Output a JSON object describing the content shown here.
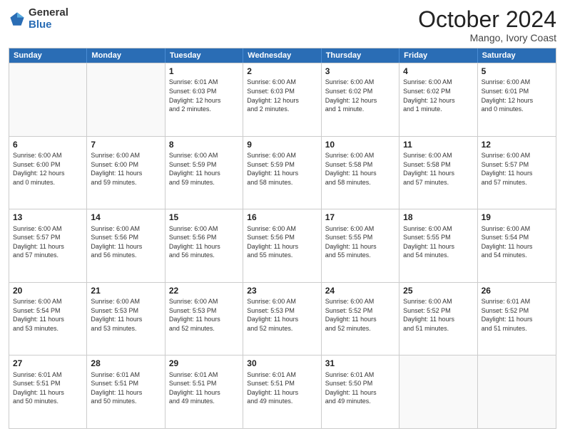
{
  "header": {
    "logo_general": "General",
    "logo_blue": "Blue",
    "month_title": "October 2024",
    "location": "Mango, Ivory Coast"
  },
  "days_of_week": [
    "Sunday",
    "Monday",
    "Tuesday",
    "Wednesday",
    "Thursday",
    "Friday",
    "Saturday"
  ],
  "weeks": [
    [
      {
        "day": "",
        "empty": true
      },
      {
        "day": "",
        "empty": true
      },
      {
        "day": "1",
        "lines": [
          "Sunrise: 6:01 AM",
          "Sunset: 6:03 PM",
          "Daylight: 12 hours",
          "and 2 minutes."
        ]
      },
      {
        "day": "2",
        "lines": [
          "Sunrise: 6:00 AM",
          "Sunset: 6:03 PM",
          "Daylight: 12 hours",
          "and 2 minutes."
        ]
      },
      {
        "day": "3",
        "lines": [
          "Sunrise: 6:00 AM",
          "Sunset: 6:02 PM",
          "Daylight: 12 hours",
          "and 1 minute."
        ]
      },
      {
        "day": "4",
        "lines": [
          "Sunrise: 6:00 AM",
          "Sunset: 6:02 PM",
          "Daylight: 12 hours",
          "and 1 minute."
        ]
      },
      {
        "day": "5",
        "lines": [
          "Sunrise: 6:00 AM",
          "Sunset: 6:01 PM",
          "Daylight: 12 hours",
          "and 0 minutes."
        ]
      }
    ],
    [
      {
        "day": "6",
        "lines": [
          "Sunrise: 6:00 AM",
          "Sunset: 6:00 PM",
          "Daylight: 12 hours",
          "and 0 minutes."
        ]
      },
      {
        "day": "7",
        "lines": [
          "Sunrise: 6:00 AM",
          "Sunset: 6:00 PM",
          "Daylight: 11 hours",
          "and 59 minutes."
        ]
      },
      {
        "day": "8",
        "lines": [
          "Sunrise: 6:00 AM",
          "Sunset: 5:59 PM",
          "Daylight: 11 hours",
          "and 59 minutes."
        ]
      },
      {
        "day": "9",
        "lines": [
          "Sunrise: 6:00 AM",
          "Sunset: 5:59 PM",
          "Daylight: 11 hours",
          "and 58 minutes."
        ]
      },
      {
        "day": "10",
        "lines": [
          "Sunrise: 6:00 AM",
          "Sunset: 5:58 PM",
          "Daylight: 11 hours",
          "and 58 minutes."
        ]
      },
      {
        "day": "11",
        "lines": [
          "Sunrise: 6:00 AM",
          "Sunset: 5:58 PM",
          "Daylight: 11 hours",
          "and 57 minutes."
        ]
      },
      {
        "day": "12",
        "lines": [
          "Sunrise: 6:00 AM",
          "Sunset: 5:57 PM",
          "Daylight: 11 hours",
          "and 57 minutes."
        ]
      }
    ],
    [
      {
        "day": "13",
        "lines": [
          "Sunrise: 6:00 AM",
          "Sunset: 5:57 PM",
          "Daylight: 11 hours",
          "and 57 minutes."
        ]
      },
      {
        "day": "14",
        "lines": [
          "Sunrise: 6:00 AM",
          "Sunset: 5:56 PM",
          "Daylight: 11 hours",
          "and 56 minutes."
        ]
      },
      {
        "day": "15",
        "lines": [
          "Sunrise: 6:00 AM",
          "Sunset: 5:56 PM",
          "Daylight: 11 hours",
          "and 56 minutes."
        ]
      },
      {
        "day": "16",
        "lines": [
          "Sunrise: 6:00 AM",
          "Sunset: 5:56 PM",
          "Daylight: 11 hours",
          "and 55 minutes."
        ]
      },
      {
        "day": "17",
        "lines": [
          "Sunrise: 6:00 AM",
          "Sunset: 5:55 PM",
          "Daylight: 11 hours",
          "and 55 minutes."
        ]
      },
      {
        "day": "18",
        "lines": [
          "Sunrise: 6:00 AM",
          "Sunset: 5:55 PM",
          "Daylight: 11 hours",
          "and 54 minutes."
        ]
      },
      {
        "day": "19",
        "lines": [
          "Sunrise: 6:00 AM",
          "Sunset: 5:54 PM",
          "Daylight: 11 hours",
          "and 54 minutes."
        ]
      }
    ],
    [
      {
        "day": "20",
        "lines": [
          "Sunrise: 6:00 AM",
          "Sunset: 5:54 PM",
          "Daylight: 11 hours",
          "and 53 minutes."
        ]
      },
      {
        "day": "21",
        "lines": [
          "Sunrise: 6:00 AM",
          "Sunset: 5:53 PM",
          "Daylight: 11 hours",
          "and 53 minutes."
        ]
      },
      {
        "day": "22",
        "lines": [
          "Sunrise: 6:00 AM",
          "Sunset: 5:53 PM",
          "Daylight: 11 hours",
          "and 52 minutes."
        ]
      },
      {
        "day": "23",
        "lines": [
          "Sunrise: 6:00 AM",
          "Sunset: 5:53 PM",
          "Daylight: 11 hours",
          "and 52 minutes."
        ]
      },
      {
        "day": "24",
        "lines": [
          "Sunrise: 6:00 AM",
          "Sunset: 5:52 PM",
          "Daylight: 11 hours",
          "and 52 minutes."
        ]
      },
      {
        "day": "25",
        "lines": [
          "Sunrise: 6:00 AM",
          "Sunset: 5:52 PM",
          "Daylight: 11 hours",
          "and 51 minutes."
        ]
      },
      {
        "day": "26",
        "lines": [
          "Sunrise: 6:01 AM",
          "Sunset: 5:52 PM",
          "Daylight: 11 hours",
          "and 51 minutes."
        ]
      }
    ],
    [
      {
        "day": "27",
        "lines": [
          "Sunrise: 6:01 AM",
          "Sunset: 5:51 PM",
          "Daylight: 11 hours",
          "and 50 minutes."
        ]
      },
      {
        "day": "28",
        "lines": [
          "Sunrise: 6:01 AM",
          "Sunset: 5:51 PM",
          "Daylight: 11 hours",
          "and 50 minutes."
        ]
      },
      {
        "day": "29",
        "lines": [
          "Sunrise: 6:01 AM",
          "Sunset: 5:51 PM",
          "Daylight: 11 hours",
          "and 49 minutes."
        ]
      },
      {
        "day": "30",
        "lines": [
          "Sunrise: 6:01 AM",
          "Sunset: 5:51 PM",
          "Daylight: 11 hours",
          "and 49 minutes."
        ]
      },
      {
        "day": "31",
        "lines": [
          "Sunrise: 6:01 AM",
          "Sunset: 5:50 PM",
          "Daylight: 11 hours",
          "and 49 minutes."
        ]
      },
      {
        "day": "",
        "empty": true
      },
      {
        "day": "",
        "empty": true
      }
    ]
  ]
}
